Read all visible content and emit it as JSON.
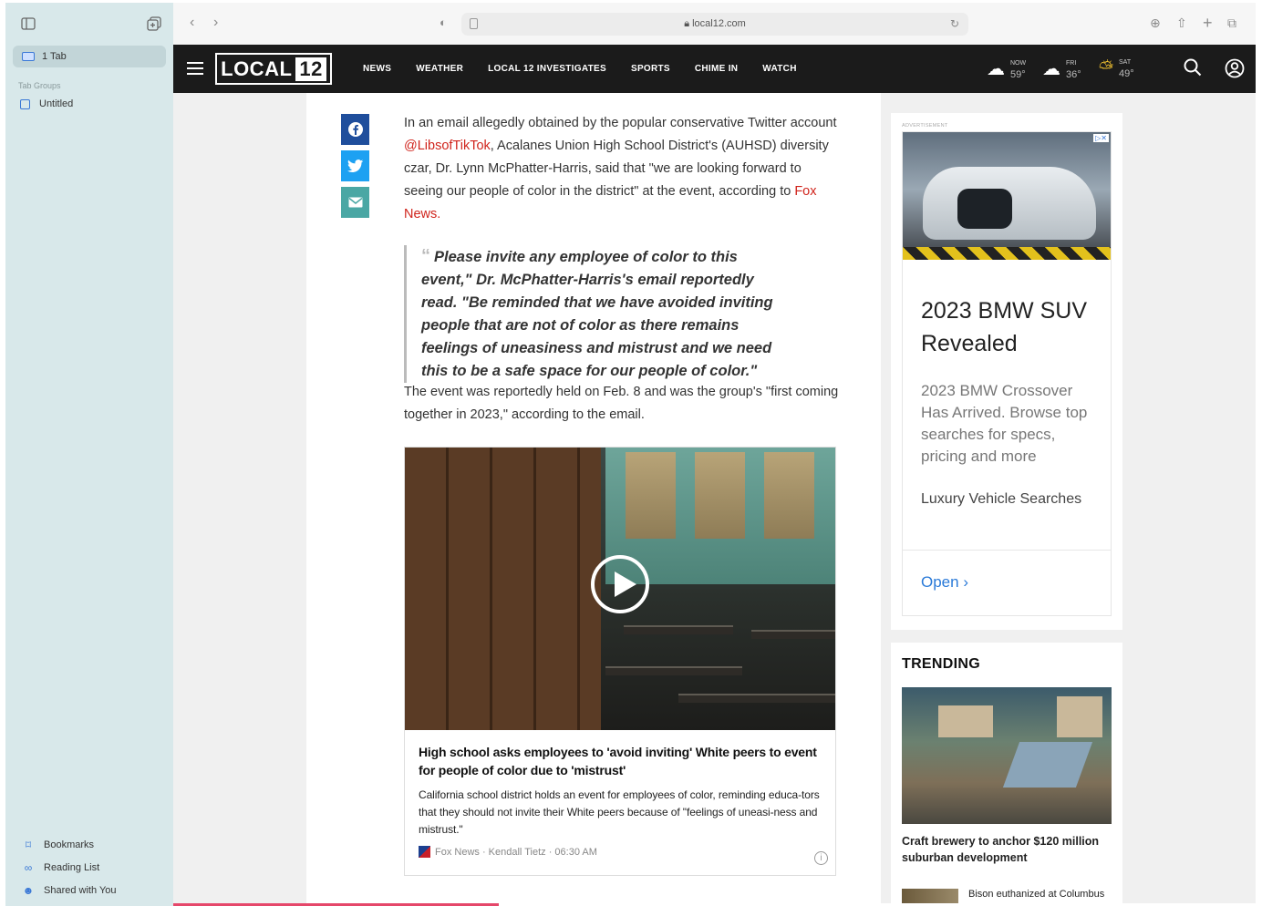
{
  "sidebar": {
    "tab_label": "1 Tab",
    "section_label": "Tab Groups",
    "group_label": "Untitled",
    "footer": [
      {
        "label": "Bookmarks",
        "icon": "bookmark-icon"
      },
      {
        "label": "Reading List",
        "icon": "reading-list-icon"
      },
      {
        "label": "Shared with You",
        "icon": "shared-with-you-icon"
      }
    ]
  },
  "browser": {
    "url": "local12.com"
  },
  "site": {
    "logo_text": "LOCAL",
    "logo_number": "12",
    "nav": [
      "NEWS",
      "WEATHER",
      "LOCAL 12 INVESTIGATES",
      "SPORTS",
      "CHIME IN",
      "WATCH"
    ],
    "weather": [
      {
        "day": "NOW",
        "temp": "59°"
      },
      {
        "day": "FRI",
        "temp": "36°"
      },
      {
        "day": "SAT",
        "temp": "49°"
      }
    ]
  },
  "article": {
    "para1_a": "In an email allegedly obtained by the popular conservative Twitter account ",
    "para1_link": "@LibsofTikTok",
    "para1_b": ", Acalanes Union High School District's (AUHSD) diversity czar, Dr. Lynn McPhatter-Harris, said that \"we are looking forward to seeing our people of color in the district\" at the event, according to ",
    "para1_link2": "Fox News.",
    "quote": "Please invite any employee of color to this event,\" Dr. McPhatter-Harris's email reportedly read. \"Be reminded that we have avoided inviting people that are not of color as there remains feelings of uneasiness and mistrust and we need this to be a safe space for our people of color.\"",
    "para2": "The event was reportedly held on Feb. 8 and was the group's \"first coming together in 2023,\" according to the email.",
    "video": {
      "title": "High school asks employees to 'avoid inviting' White peers to event for people of color due to 'mistrust'",
      "description": "California school district holds an event for employees of color, reminding educa-tors that they should not invite their White peers because of \"feelings of uneasi-ness and mistrust.\"",
      "meta": "Fox News · Kendall Tietz · 06:30 AM"
    }
  },
  "ad": {
    "label": "ADVERTISEMENT",
    "title": "2023 BMW SUV Revealed",
    "description": "2023 BMW Crossover Has Arrived. Browse top searches for specs, pricing and more",
    "sponsor": "Luxury Vehicle Searches",
    "cta": "Open"
  },
  "trending": {
    "title": "TRENDING",
    "headline": "Craft brewery to anchor $120 million suburban development",
    "item2": "Bison euthanized at Columbus"
  },
  "colors": {
    "nav_bg": "#1b1b1b",
    "link_red": "#d0241c",
    "facebook": "#1f4e9c",
    "twitter": "#1da1f2",
    "email": "#4aa7a4",
    "sidebar_bg": "#d8e8ea"
  }
}
